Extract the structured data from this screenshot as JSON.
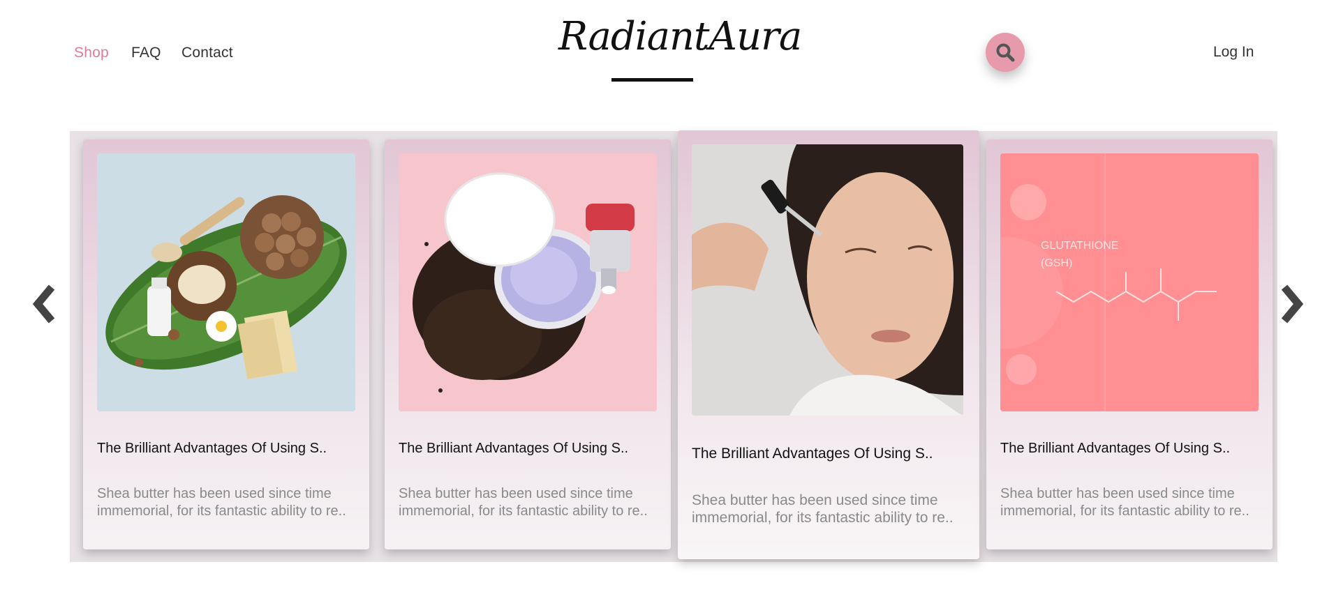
{
  "nav": {
    "shop": "Shop",
    "faq": "FAQ",
    "contact": "Contact",
    "login": "Log In"
  },
  "brand": {
    "name": "RadiantAura",
    "accent": "#e07b97",
    "search_button_color": "#e79aab"
  },
  "icons": {
    "search": "search-icon",
    "prev": "chevron-left-icon",
    "next": "chevron-right-icon"
  },
  "cards": [
    {
      "title": "The Brilliant Advantages Of Using S..",
      "description": "Shea butter has been used since time immemorial, for its fantastic ability to re.."
    },
    {
      "title": "The Brilliant Advantages Of Using S..",
      "description": "Shea butter has been used since time immemorial, for its fantastic ability to re.."
    },
    {
      "title": "The Brilliant Advantages Of Using S..",
      "description": "Shea butter has been used since time immemorial, for its fantastic ability to re.."
    },
    {
      "title": "The Brilliant Advantages Of Using S..",
      "description": "Shea butter has been used since time immemorial, for its fantastic ability to re.."
    }
  ],
  "image_texts": {
    "glutathione": "GLUTATHIONE",
    "gsh": "(GSH)"
  }
}
